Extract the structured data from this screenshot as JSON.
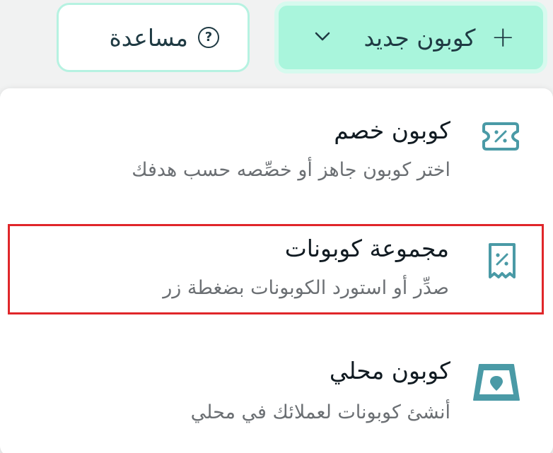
{
  "header": {
    "new_coupon_label": "كوبون جديد",
    "help_label": "مساعدة"
  },
  "menu": {
    "items": [
      {
        "title": "كوبون خصم",
        "desc": "اختر كوبون جاهز أو خصِّصه حسب هدفك",
        "icon": "discount-ticket-icon"
      },
      {
        "title": "مجموعة كوبونات",
        "desc": "صدِّر أو استورد الكوبونات بضغطة زر",
        "icon": "coupon-receipt-icon"
      },
      {
        "title": "كوبون محلي",
        "desc": "أنشئ كوبونات لعملائك في محلي",
        "icon": "store-location-icon"
      }
    ]
  },
  "colors": {
    "accent": "#a9f5dc",
    "icon_teal": "#4a9aa6",
    "highlight_border": "#e0262a"
  }
}
